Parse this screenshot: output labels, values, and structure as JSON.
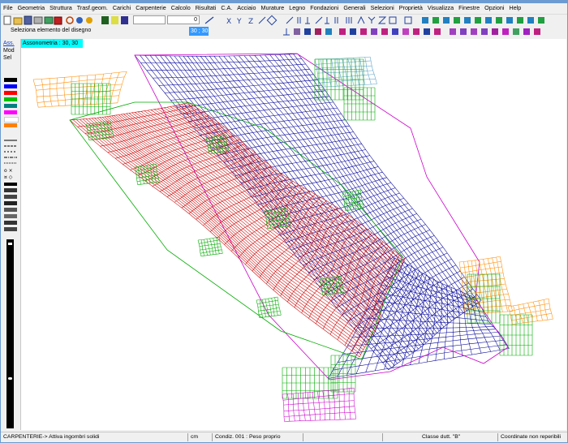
{
  "menu": [
    "File",
    "Geometria",
    "Struttura",
    "Trasf.geom.",
    "Carichi",
    "Carpenterie",
    "Calcolo",
    "Risultati",
    "C.A.",
    "Acciaio",
    "Murature",
    "Legno",
    "Fondazioni",
    "Generali",
    "Selezioni",
    "Proprietà",
    "Visualizza",
    "Finestre",
    "Opzioni",
    "Help"
  ],
  "toolbar": {
    "prompt": "Seleziona  elemento del disegno",
    "coordinate_value": "30 ; 30",
    "numeric_field": "0"
  },
  "left_panel": {
    "view_labels": [
      "Ass.",
      "Mod",
      "Sel"
    ],
    "color_swatches": [
      "#000000",
      "#0000ff",
      "#ff0000",
      "#00c000",
      "#008080",
      "#ff00ff",
      "#ffffff",
      "#ff8000"
    ]
  },
  "canvas": {
    "view_label": "Assonometria :  30, 30",
    "mesh_colors": {
      "red": "#cc0000",
      "green": "#00aa00",
      "blue": "#000099",
      "magenta": "#cc00cc",
      "orange": "#ff8c00",
      "light_blue": "#5aa0c8"
    }
  },
  "status": {
    "mode": "CARPENTERIE-> Attiva ingombri solidi",
    "units": "cm",
    "condition": "Condiz. 001 : Peso proprio",
    "ductility_class": "Classe dutt. \"B\"",
    "coordinates": "Coordinate non reperibili"
  }
}
